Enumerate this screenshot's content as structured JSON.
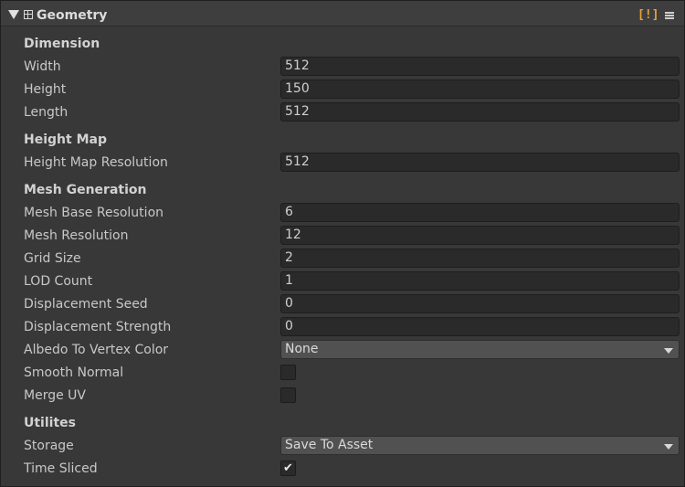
{
  "header": {
    "title": "Geometry",
    "warning_badge": "[!]",
    "icons": {
      "foldout": "triangle-down-icon",
      "component": "grid-icon",
      "menu": "hamburger-menu-icon"
    }
  },
  "colors": {
    "panel_bg": "#383838",
    "field_bg": "#2a2a2a",
    "dropdown_bg": "#515151",
    "warning": "#e8a33a"
  },
  "sections": {
    "dimension": {
      "title": "Dimension",
      "width": {
        "label": "Width",
        "value": "512"
      },
      "height": {
        "label": "Height",
        "value": "150"
      },
      "length": {
        "label": "Length",
        "value": "512"
      }
    },
    "height_map": {
      "title": "Height Map",
      "resolution": {
        "label": "Height Map Resolution",
        "value": "512"
      }
    },
    "mesh_generation": {
      "title": "Mesh Generation",
      "mesh_base_resolution": {
        "label": "Mesh Base Resolution",
        "value": "6"
      },
      "mesh_resolution": {
        "label": "Mesh Resolution",
        "value": "12"
      },
      "grid_size": {
        "label": "Grid Size",
        "value": "2"
      },
      "lod_count": {
        "label": "LOD Count",
        "value": "1"
      },
      "displacement_seed": {
        "label": "Displacement Seed",
        "value": "0"
      },
      "displacement_strength": {
        "label": "Displacement Strength",
        "value": "0"
      },
      "albedo_to_vertex_color": {
        "label": "Albedo To Vertex Color",
        "value": "None"
      },
      "smooth_normal": {
        "label": "Smooth Normal",
        "checked": false
      },
      "merge_uv": {
        "label": "Merge UV",
        "checked": false
      }
    },
    "utilities": {
      "title": "Utilites",
      "storage": {
        "label": "Storage",
        "value": "Save To Asset"
      },
      "time_sliced": {
        "label": "Time Sliced",
        "checked": true,
        "check_glyph": "✔"
      }
    }
  }
}
